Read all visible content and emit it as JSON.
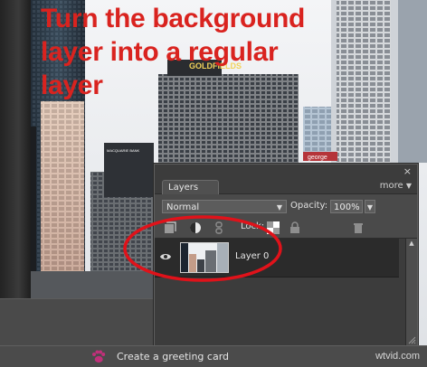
{
  "headline": {
    "line1": "Turn the background",
    "line2": "layer into a regular",
    "line3": "layer"
  },
  "photo_signs": {
    "rooftop": "GOLDFIELDS",
    "tower": "MACQUARIE BANK",
    "shop": "george"
  },
  "layers_panel": {
    "close_glyph": "×",
    "tab_label": "Layers",
    "more_label": "more",
    "blend_mode": "Normal",
    "opacity_label": "Opacity:",
    "opacity_value": "100%",
    "lock_label": "Lock:",
    "layers": [
      {
        "name": "Layer 0",
        "visible": true
      }
    ]
  },
  "bottom_bar": {
    "label": "Create a greeting card",
    "watermark": "wtvid.com"
  },
  "colors": {
    "headline": "#d9231f",
    "annotation_circle": "#e0121a",
    "panel": "#4a4a4a"
  },
  "icons": [
    "close-icon",
    "eye-icon",
    "new-layer-icon",
    "adjustment-layer-icon",
    "link-icon",
    "lock-transparency-icon",
    "lock-all-icon",
    "trash-icon",
    "paw-icon"
  ]
}
